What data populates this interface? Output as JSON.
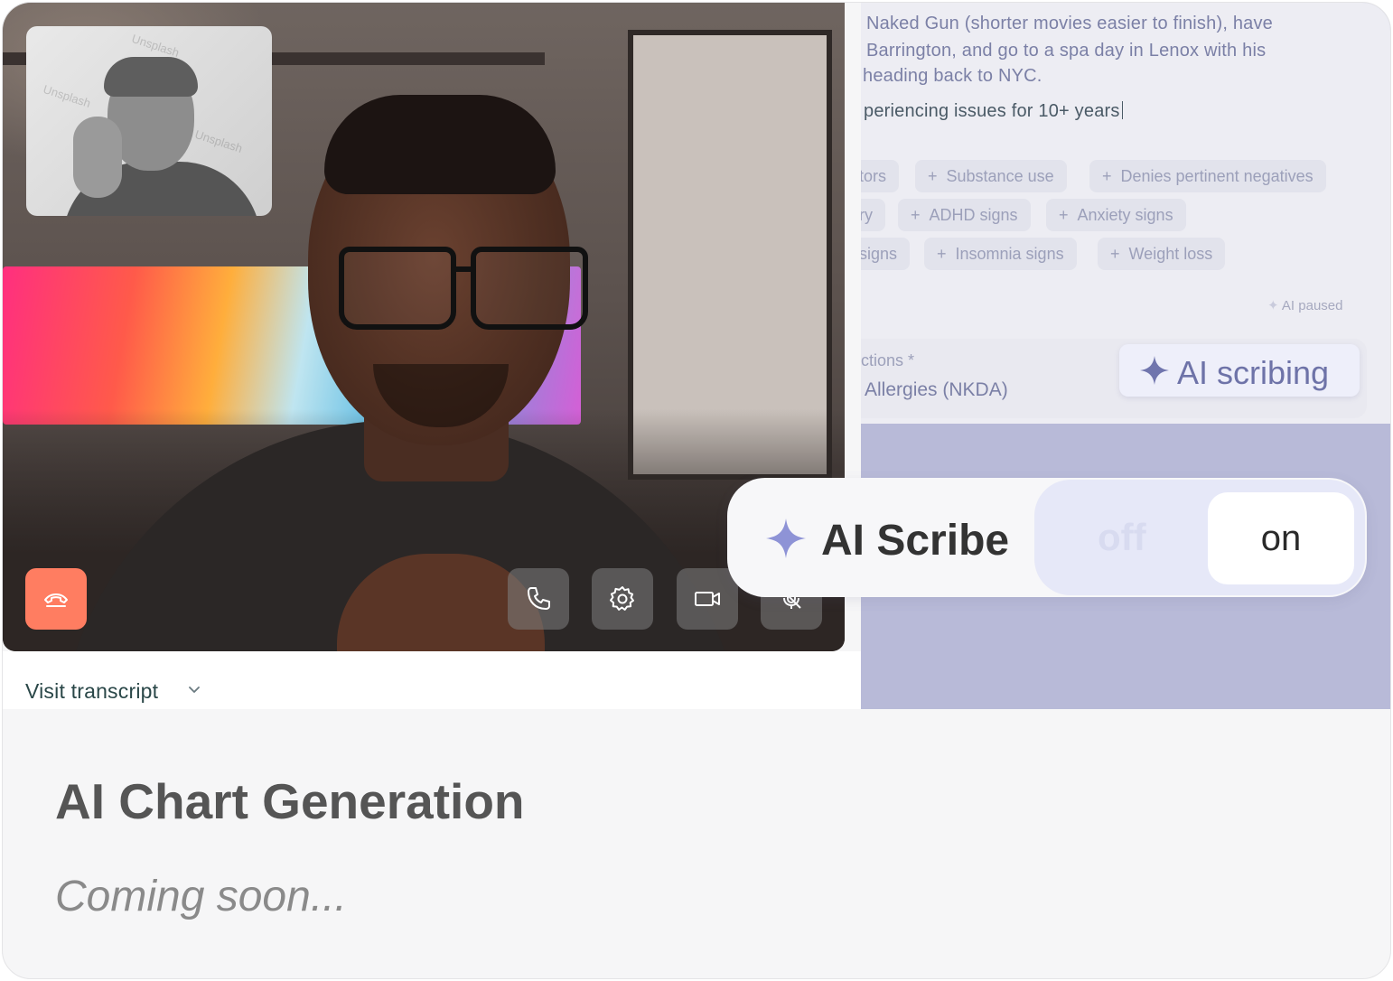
{
  "notes": {
    "lines": [
      "Naked Gun (shorter movies easier to finish), have",
      "Barrington, and go to a spa day in Lenox with his",
      "heading back to NYC."
    ],
    "current_line": "periencing issues for 10+ years"
  },
  "chips": [
    [
      "tors",
      "Substance use",
      "Denies pertinent negatives"
    ],
    [
      "ry",
      "ADHD signs",
      "Anxiety signs"
    ],
    [
      "signs",
      "Insomnia signs",
      "Weight loss"
    ]
  ],
  "ai_paused": "AI paused",
  "section": {
    "label": "ctions *",
    "value": "Allergies (NKDA)"
  },
  "ai_scribing": "AI scribing",
  "toggle": {
    "label": "AI Scribe",
    "off": "off",
    "on": "on"
  },
  "transcript": {
    "label": "Visit transcript"
  },
  "pip_watermark": "Unsplash",
  "footer": {
    "title": "AI Chart Generation",
    "subtitle": "Coming soon..."
  },
  "colors": {
    "end_call": "#ff7d61",
    "accent": "#8e93d6",
    "right_panel": "#b8bad8"
  }
}
